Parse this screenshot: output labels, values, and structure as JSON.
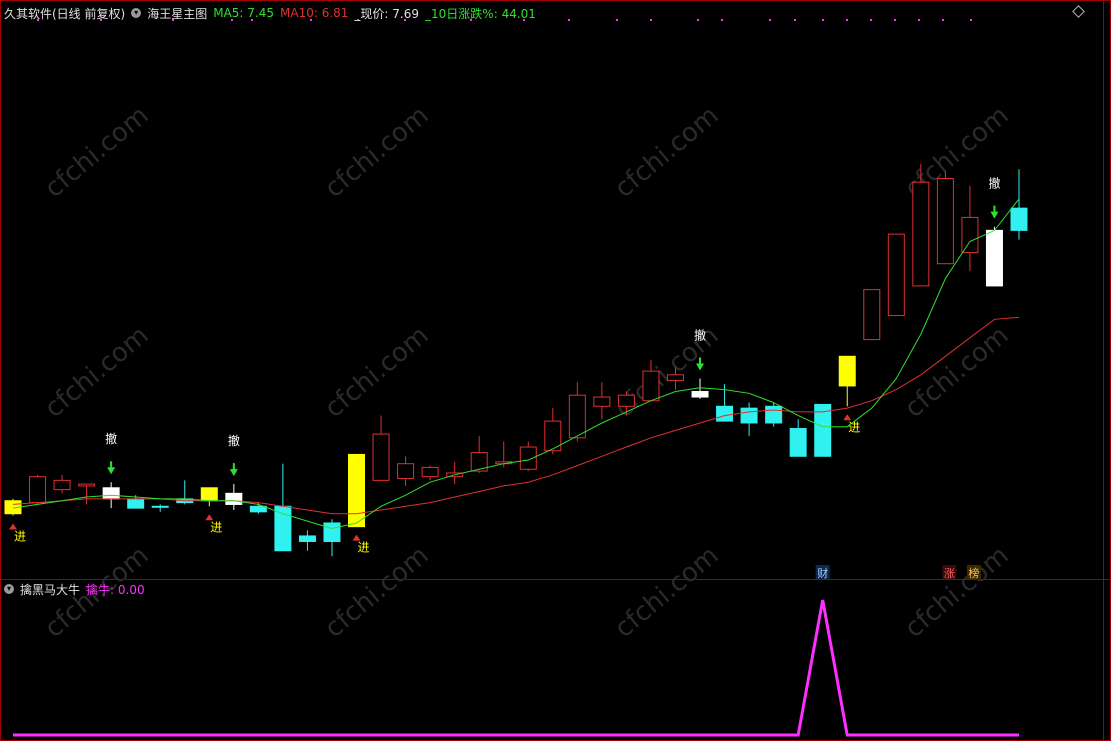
{
  "header": {
    "app_title": "久其软件(日线 前复权)",
    "indicator_name": "海王星主图",
    "ma5_label": "MA5:",
    "ma5_value": "7.45",
    "ma10_label": "MA10:",
    "ma10_value": "6.81",
    "price_label": "_现价:",
    "price_value": "7.69",
    "change_label": "_10日涨跌%:",
    "change_value": "44.01"
  },
  "sub_header": {
    "indicator_name": "擒黑马大牛",
    "value_label": "擒牛:",
    "value": "0.00"
  },
  "markers": {
    "buy": "进",
    "sell": "撤",
    "cai": "财",
    "zhang": "涨",
    "bang": "榜"
  },
  "watermark": "cfchi.com",
  "colors": {
    "up": "#e03030",
    "down": "#30f0f0",
    "yellow": "#ffff00",
    "white": "#ffffff",
    "ma5": "#30e030",
    "ma10": "#e03030",
    "sub": "#ff30ff",
    "border": "#a00000"
  },
  "chart_data": {
    "type": "candlestick",
    "price_range": [
      5.5,
      8.2
    ],
    "candles": [
      {
        "o": 5.75,
        "c": 5.82,
        "h": 5.83,
        "l": 5.74,
        "color": "yellow"
      },
      {
        "o": 5.81,
        "c": 5.95,
        "h": 5.96,
        "l": 5.8,
        "color": "up"
      },
      {
        "o": 5.88,
        "c": 5.93,
        "h": 5.96,
        "l": 5.86,
        "color": "up"
      },
      {
        "o": 5.9,
        "c": 5.91,
        "h": 5.91,
        "l": 5.8,
        "color": "up"
      },
      {
        "o": 5.89,
        "c": 5.83,
        "h": 5.92,
        "l": 5.78,
        "color": "white"
      },
      {
        "o": 5.83,
        "c": 5.78,
        "h": 5.85,
        "l": 5.78,
        "color": "down"
      },
      {
        "o": 5.79,
        "c": 5.79,
        "h": 5.8,
        "l": 5.76,
        "color": "down"
      },
      {
        "o": 5.83,
        "c": 5.81,
        "h": 5.93,
        "l": 5.8,
        "color": "down"
      },
      {
        "o": 5.82,
        "c": 5.89,
        "h": 5.89,
        "l": 5.79,
        "color": "yellow"
      },
      {
        "o": 5.86,
        "c": 5.8,
        "h": 5.91,
        "l": 5.77,
        "color": "white"
      },
      {
        "o": 5.79,
        "c": 5.76,
        "h": 5.81,
        "l": 5.75,
        "color": "down"
      },
      {
        "o": 5.79,
        "c": 5.55,
        "h": 6.02,
        "l": 5.55,
        "color": "down"
      },
      {
        "o": 5.63,
        "c": 5.6,
        "h": 5.66,
        "l": 5.55,
        "color": "down"
      },
      {
        "o": 5.7,
        "c": 5.6,
        "h": 5.72,
        "l": 5.52,
        "color": "down"
      },
      {
        "o": 5.68,
        "c": 6.07,
        "h": 6.07,
        "l": 5.68,
        "color": "yellow"
      },
      {
        "o": 5.93,
        "c": 6.18,
        "h": 6.28,
        "l": 5.93,
        "color": "up"
      },
      {
        "o": 5.94,
        "c": 6.02,
        "h": 6.06,
        "l": 5.9,
        "color": "up"
      },
      {
        "o": 5.95,
        "c": 6.0,
        "h": 6.01,
        "l": 5.93,
        "color": "up"
      },
      {
        "o": 5.95,
        "c": 5.97,
        "h": 6.03,
        "l": 5.91,
        "color": "up"
      },
      {
        "o": 5.98,
        "c": 6.08,
        "h": 6.17,
        "l": 5.97,
        "color": "up"
      },
      {
        "o": 6.02,
        "c": 6.03,
        "h": 6.14,
        "l": 6.0,
        "color": "up"
      },
      {
        "o": 5.99,
        "c": 6.11,
        "h": 6.14,
        "l": 5.98,
        "color": "up"
      },
      {
        "o": 6.09,
        "c": 6.25,
        "h": 6.32,
        "l": 6.07,
        "color": "up"
      },
      {
        "o": 6.16,
        "c": 6.39,
        "h": 6.46,
        "l": 6.14,
        "color": "up"
      },
      {
        "o": 6.33,
        "c": 6.38,
        "h": 6.46,
        "l": 6.26,
        "color": "up"
      },
      {
        "o": 6.33,
        "c": 6.39,
        "h": 6.41,
        "l": 6.28,
        "color": "up"
      },
      {
        "o": 6.36,
        "c": 6.52,
        "h": 6.58,
        "l": 6.36,
        "color": "up"
      },
      {
        "o": 6.47,
        "c": 6.5,
        "h": 6.54,
        "l": 6.42,
        "color": "up"
      },
      {
        "o": 6.41,
        "c": 6.38,
        "h": 6.48,
        "l": 6.37,
        "color": "white"
      },
      {
        "o": 6.33,
        "c": 6.25,
        "h": 6.45,
        "l": 6.25,
        "color": "down"
      },
      {
        "o": 6.32,
        "c": 6.24,
        "h": 6.35,
        "l": 6.17,
        "color": "down"
      },
      {
        "o": 6.33,
        "c": 6.24,
        "h": 6.35,
        "l": 6.22,
        "color": "down"
      },
      {
        "o": 6.21,
        "c": 6.06,
        "h": 6.26,
        "l": 6.06,
        "color": "down"
      },
      {
        "o": 6.34,
        "c": 6.06,
        "h": 6.34,
        "l": 6.06,
        "color": "down"
      },
      {
        "o": 6.44,
        "c": 6.6,
        "h": 6.6,
        "l": 6.33,
        "color": "yellow"
      },
      {
        "o": 6.69,
        "c": 6.96,
        "h": 6.96,
        "l": 6.69,
        "color": "up"
      },
      {
        "o": 6.82,
        "c": 7.26,
        "h": 7.26,
        "l": 6.82,
        "color": "up"
      },
      {
        "o": 6.98,
        "c": 7.54,
        "h": 7.64,
        "l": 6.98,
        "color": "up"
      },
      {
        "o": 7.1,
        "c": 7.56,
        "h": 7.6,
        "l": 7.1,
        "color": "up"
      },
      {
        "o": 7.16,
        "c": 7.35,
        "h": 7.52,
        "l": 7.06,
        "color": "up"
      },
      {
        "o": 7.28,
        "c": 6.98,
        "h": 7.3,
        "l": 6.98,
        "color": "white"
      },
      {
        "o": 7.4,
        "c": 7.28,
        "h": 7.61,
        "l": 7.23,
        "color": "down"
      }
    ],
    "ma5": [
      5.78,
      5.8,
      5.82,
      5.84,
      5.85,
      5.84,
      5.83,
      5.83,
      5.82,
      5.82,
      5.8,
      5.75,
      5.71,
      5.67,
      5.7,
      5.79,
      5.85,
      5.92,
      5.96,
      5.99,
      6.02,
      6.04,
      6.1,
      6.17,
      6.24,
      6.3,
      6.36,
      6.41,
      6.43,
      6.42,
      6.4,
      6.35,
      6.28,
      6.22,
      6.22,
      6.32,
      6.48,
      6.72,
      7.02,
      7.22,
      7.28,
      7.45
    ],
    "ma10": [
      5.8,
      5.81,
      5.82,
      5.83,
      5.83,
      5.83,
      5.83,
      5.82,
      5.82,
      5.82,
      5.81,
      5.79,
      5.77,
      5.75,
      5.75,
      5.77,
      5.79,
      5.81,
      5.84,
      5.87,
      5.9,
      5.92,
      5.96,
      6.01,
      6.06,
      6.11,
      6.16,
      6.2,
      6.24,
      6.28,
      6.3,
      6.31,
      6.3,
      6.3,
      6.32,
      6.36,
      6.42,
      6.5,
      6.6,
      6.7,
      6.8,
      6.81
    ],
    "signals": [
      {
        "i": 0,
        "type": "buy"
      },
      {
        "i": 4,
        "type": "sell"
      },
      {
        "i": 8,
        "type": "buy"
      },
      {
        "i": 9,
        "type": "sell"
      },
      {
        "i": 14,
        "type": "buy"
      },
      {
        "i": 28,
        "type": "sell"
      },
      {
        "i": 34,
        "type": "buy"
      },
      {
        "i": 40,
        "type": "sell"
      }
    ],
    "sub_values": [
      0,
      0,
      0,
      0,
      0,
      0,
      0,
      0,
      0,
      0,
      0,
      0,
      0,
      0,
      0,
      0,
      0,
      0,
      0,
      0,
      0,
      0,
      0,
      0,
      0,
      0,
      0,
      0,
      0,
      0,
      0,
      0,
      0,
      1,
      0,
      0,
      0,
      0,
      0,
      0,
      0,
      0
    ],
    "sub_range": [
      0,
      1
    ]
  }
}
